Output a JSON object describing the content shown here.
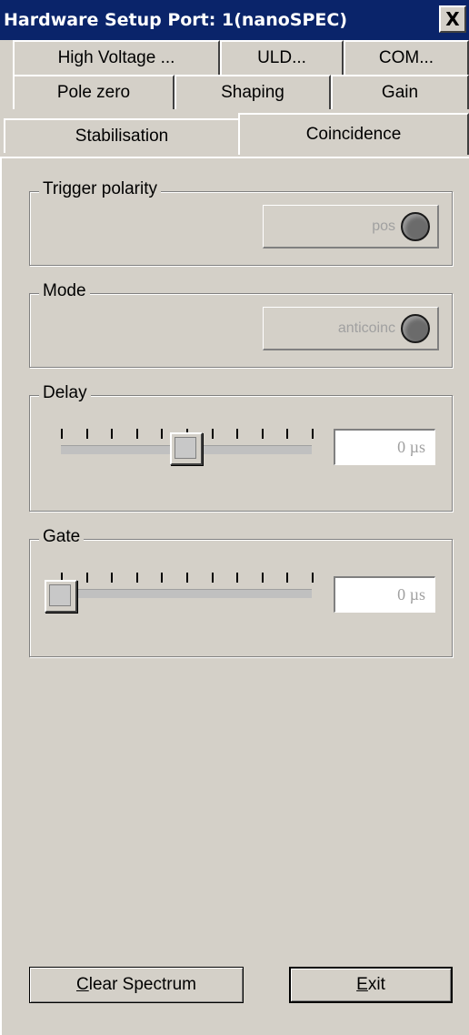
{
  "window": {
    "title": "Hardware Setup Port: 1(nanoSPEC)",
    "close_glyph": "X"
  },
  "tabs": {
    "row1": [
      "High Voltage ...",
      "ULD...",
      "COM..."
    ],
    "row2": [
      "Pole zero",
      "Shaping",
      "Gain"
    ],
    "row3": [
      "Stabilisation",
      "Coincidence"
    ],
    "active": "Coincidence"
  },
  "trigger_polarity": {
    "label": "Trigger polarity",
    "button_text": "pos",
    "led_icon": "led-off-icon"
  },
  "mode": {
    "label": "Mode",
    "button_text": "anticoinc",
    "led_icon": "led-off-icon"
  },
  "delay": {
    "label": "Delay",
    "value": "0",
    "unit": "µs",
    "display": "0  µs",
    "slider_position": 0.5
  },
  "gate": {
    "label": "Gate",
    "value": "0",
    "unit": "µs",
    "display": "0  µs",
    "slider_position": 0.0
  },
  "buttons": {
    "clear_prefix": "C",
    "clear_rest": "lear Spectrum",
    "exit_prefix": "E",
    "exit_rest": "xit"
  },
  "colors": {
    "titlebar": "#0a246a",
    "background": "#d4d0c8",
    "disabled_text": "#a0a0a0"
  }
}
